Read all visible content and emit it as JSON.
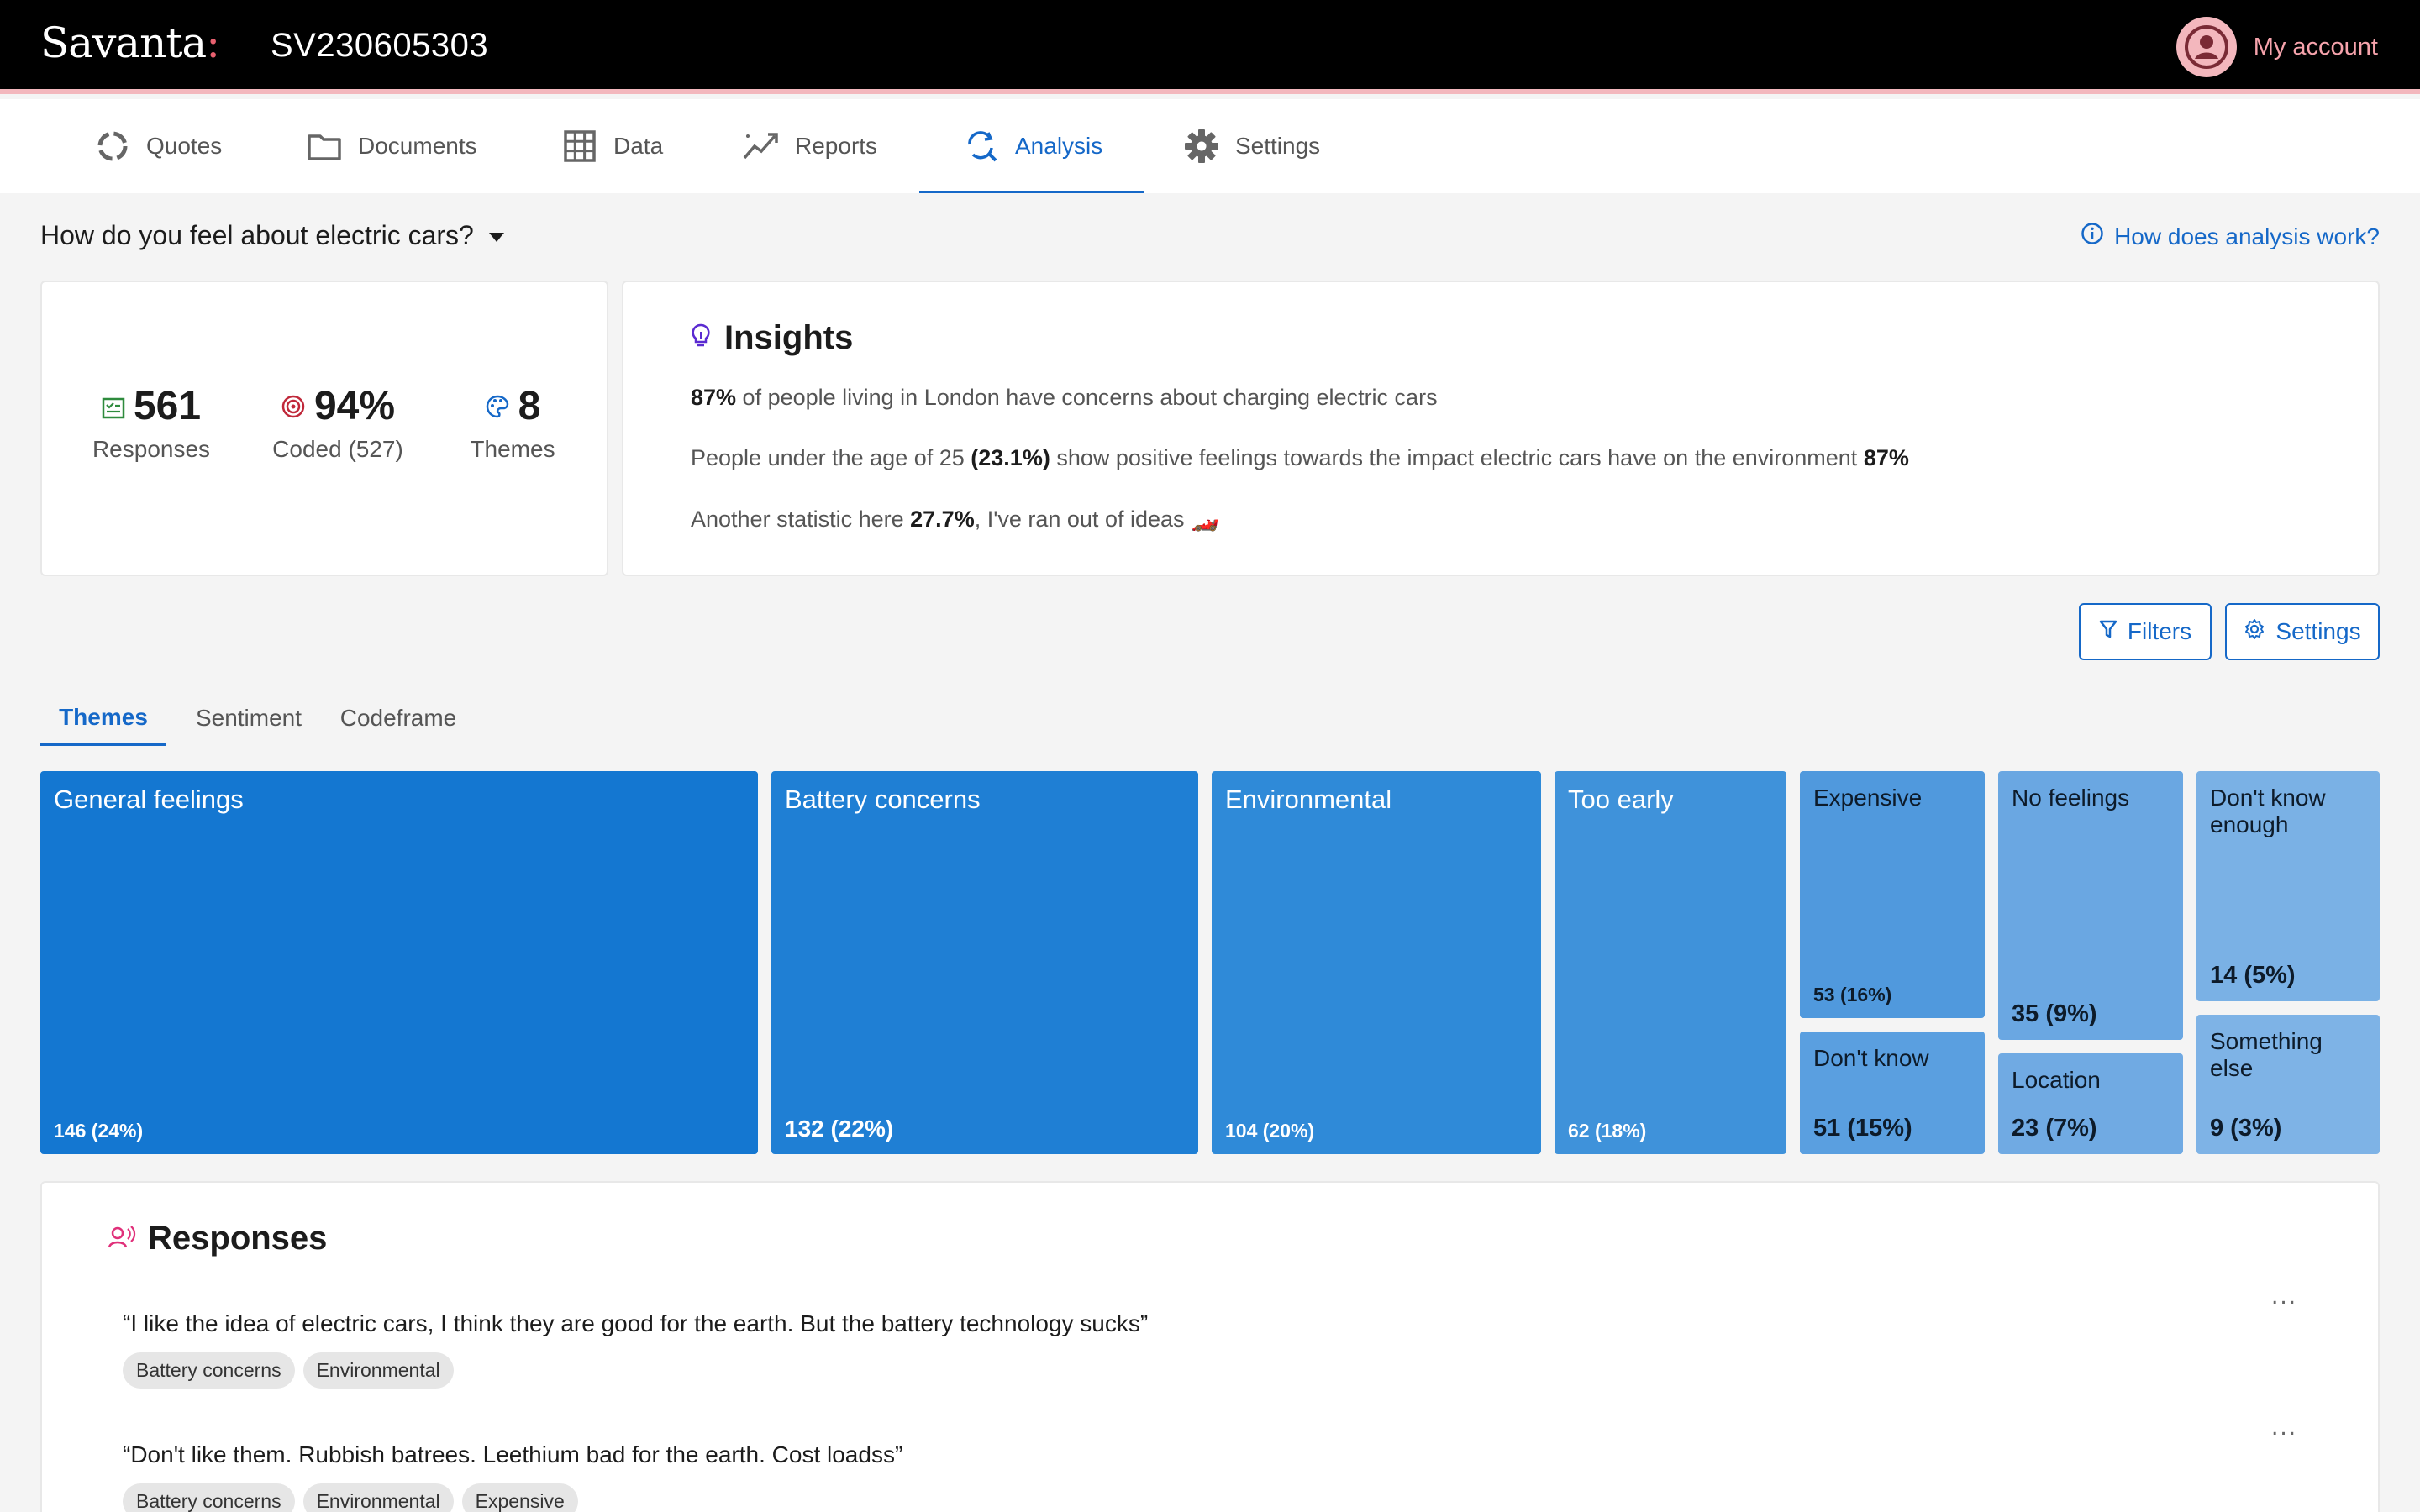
{
  "header": {
    "logo": "Savanta",
    "logo_suffix": ":",
    "project_id": "SV230605303",
    "account_label": "My account",
    "account_icon": "user-circle-icon"
  },
  "nav": {
    "items": [
      {
        "label": "Quotes",
        "icon": "spinner-icon"
      },
      {
        "label": "Documents",
        "icon": "folder-icon"
      },
      {
        "label": "Data",
        "icon": "grid-table-icon"
      },
      {
        "label": "Reports",
        "icon": "trend-chart-icon"
      },
      {
        "label": "Analysis",
        "icon": "refresh-search-icon",
        "active": true
      },
      {
        "label": "Settings",
        "icon": "gear-icon"
      }
    ]
  },
  "question": {
    "text": "How do you feel about electric cars?",
    "help_link": "How does analysis work?"
  },
  "stats": {
    "responses_value": "561",
    "responses_label": "Responses",
    "coded_value": "94%",
    "coded_label": "Coded (527)",
    "themes_value": "8",
    "themes_label": "Themes"
  },
  "insights": {
    "title": "Insights",
    "line1_bold": "87%",
    "line1_text": " of people living in London have concerns about charging electric cars",
    "line2_text_a": "People under the age of 25 ",
    "line2_bold_a": "(23.1%)",
    "line2_text_b": " show positive feelings towards the impact electric cars have on the environment ",
    "line2_bold_b": "87%",
    "line3_text_a": "Another statistic here ",
    "line3_bold": "27.7%",
    "line3_text_b": ", I've ran out of ideas 🏎️"
  },
  "actions": {
    "filters_label": "Filters",
    "settings_label": "Settings"
  },
  "tabs": {
    "items": [
      "Themes",
      "Sentiment",
      "Codeframe"
    ],
    "active": "Themes"
  },
  "themes": [
    {
      "name": "General feelings",
      "count": "146 (24%)",
      "color": "#1477d1"
    },
    {
      "name": "Battery concerns",
      "count": "132 (22%)",
      "color": "#1f7fd4"
    },
    {
      "name": "Environmental",
      "count": "104 (20%)",
      "color": "#2f8ad8"
    },
    {
      "name": "Too early",
      "count": "62 (18%)",
      "color": "#3f92da"
    },
    {
      "name": "Expensive",
      "count": "53 (16%)",
      "color": "#5099dd"
    },
    {
      "name": "Don't know",
      "count": "51 (15%)",
      "color": "#5a9fe0"
    },
    {
      "name": "No feelings",
      "count": "35 (9%)",
      "color": "#6aa7e2"
    },
    {
      "name": "Location",
      "count": "23 (7%)",
      "color": "#70aae3"
    },
    {
      "name": "Don't know enough",
      "count": "14 (5%)",
      "color": "#7ab1e5"
    },
    {
      "name": "Something else",
      "count": "9 (3%)",
      "color": "#7eb3e6"
    }
  ],
  "responses": {
    "title": "Responses",
    "items": [
      {
        "text": "“I like the idea of electric cars, I think they are good for the earth. But the battery technology sucks”",
        "tags": [
          "Battery concerns",
          "Environmental"
        ]
      },
      {
        "text": "“Don't like them. Rubbish batrees. Leethium bad for the earth. Cost loadss”",
        "tags": [
          "Battery concerns",
          "Environmental",
          "Expensive"
        ]
      }
    ],
    "more_label": "..."
  },
  "colors": {
    "accent": "#1568c8",
    "topbar": "#000000",
    "brand_pink": "#f3b7bd"
  }
}
